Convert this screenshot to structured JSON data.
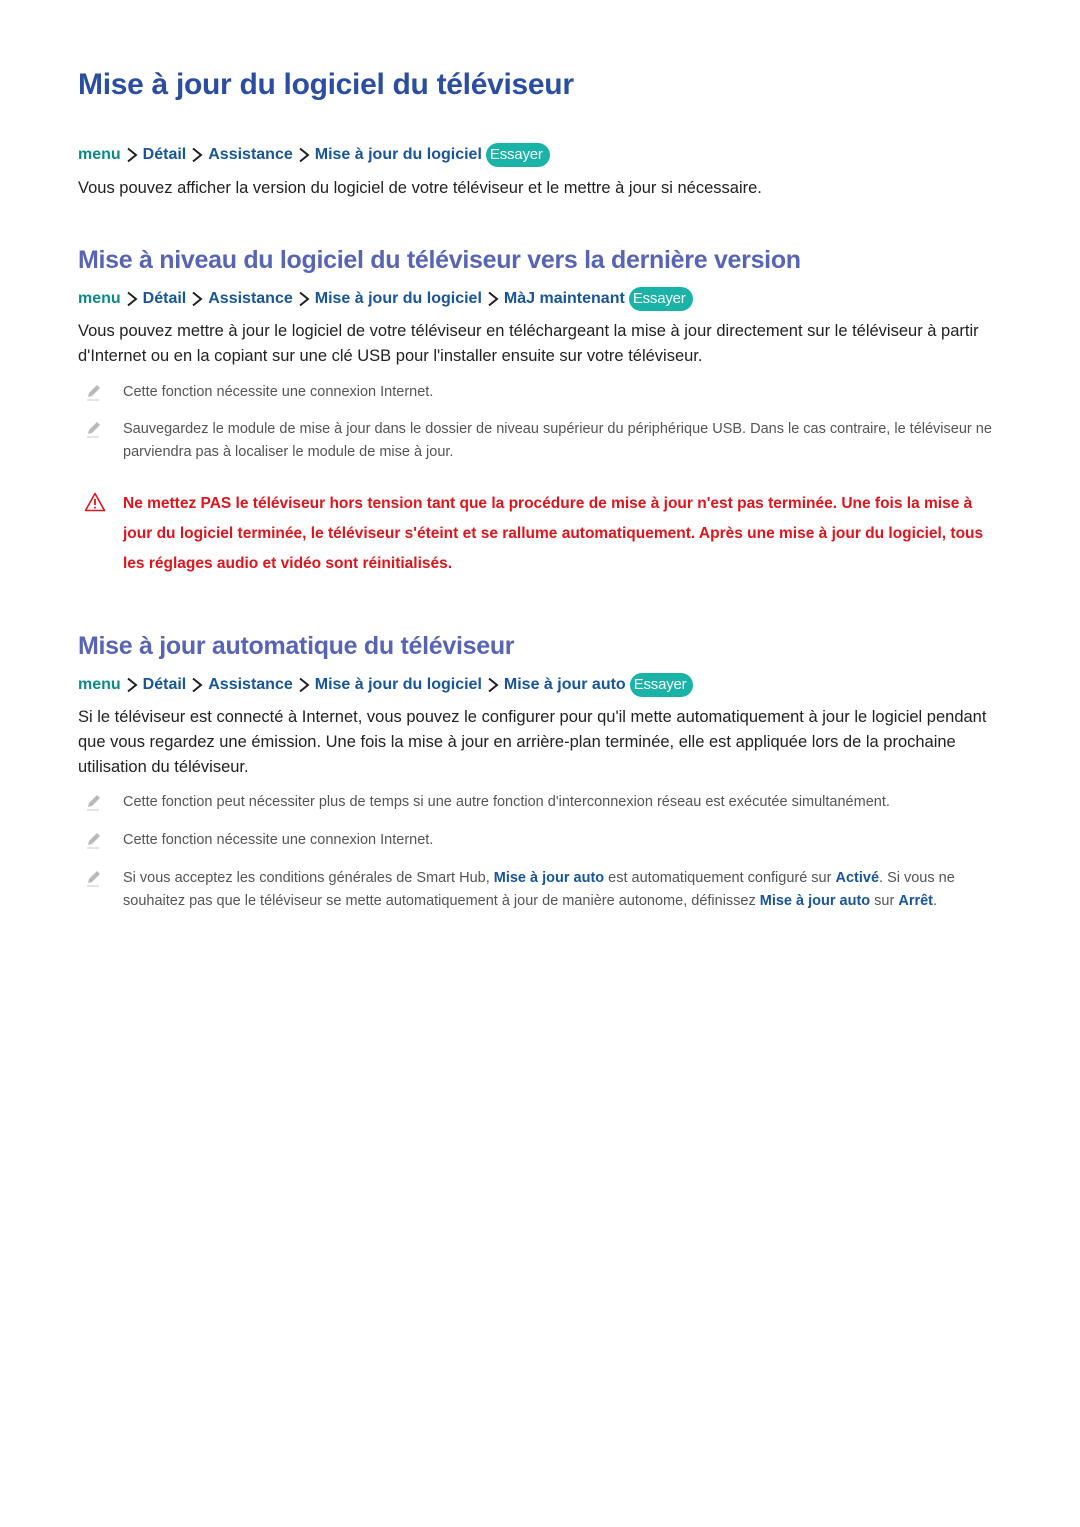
{
  "colors": {
    "title": "#2b4ea2",
    "subtitle": "#5865b6",
    "breadcrumb_root": "#0b8a8a",
    "breadcrumb_item": "#17559c",
    "try_badge": "#1ab3a8",
    "warning": "#e2141b",
    "note_text": "#555555"
  },
  "main_title": "Mise à jour du logiciel du téléviseur",
  "section1": {
    "breadcrumb": {
      "root": "menu",
      "items": [
        "Détail",
        "Assistance",
        "Mise à jour du logiciel"
      ],
      "try_label": "Essayer"
    },
    "body": "Vous pouvez afficher la version du logiciel de votre téléviseur et le mettre à jour si nécessaire."
  },
  "section2": {
    "title": "Mise à niveau du logiciel du téléviseur vers la dernière version",
    "breadcrumb": {
      "root": "menu",
      "items": [
        "Détail",
        "Assistance",
        "Mise à jour du logiciel",
        "MàJ maintenant"
      ],
      "try_label": "Essayer"
    },
    "body": "Vous pouvez mettre à jour le logiciel de votre téléviseur en téléchargeant la mise à jour directement sur le téléviseur à partir d'Internet ou en la copiant sur une clé USB pour l'installer ensuite sur votre téléviseur.",
    "notes": [
      {
        "icon": "pencil-note-icon",
        "text": "Cette fonction nécessite une connexion Internet."
      },
      {
        "icon": "pencil-note-icon",
        "text": "Sauvegardez le module de mise à jour dans le dossier de niveau supérieur du périphérique USB. Dans le cas contraire, le téléviseur ne parviendra pas à localiser le module de mise à jour."
      }
    ],
    "warning": {
      "icon": "warning-triangle-icon",
      "text": "Ne mettez PAS le téléviseur hors tension tant que la procédure de mise à jour n'est pas terminée. Une fois la mise à jour du logiciel terminée, le téléviseur s'éteint et se rallume automatiquement. Après une mise à jour du logiciel, tous les réglages audio et vidéo sont réinitialisés."
    }
  },
  "section3": {
    "title": "Mise à jour automatique du téléviseur",
    "breadcrumb": {
      "root": "menu",
      "items": [
        "Détail",
        "Assistance",
        "Mise à jour du logiciel",
        "Mise à jour auto"
      ],
      "try_label": "Essayer"
    },
    "body": "Si le téléviseur est connecté à Internet, vous pouvez le configurer pour qu'il mette automatiquement à jour le logiciel pendant que vous regardez une émission. Une fois la mise à jour en arrière-plan terminée, elle est appliquée lors de la prochaine utilisation du téléviseur.",
    "notes": [
      {
        "icon": "pencil-note-icon",
        "text": "Cette fonction peut nécessiter plus de temps si une autre fonction d'interconnexion réseau est exécutée simultanément."
      },
      {
        "icon": "pencil-note-icon",
        "text": "Cette fonction nécessite une connexion Internet."
      }
    ],
    "note3": {
      "icon": "pencil-note-icon",
      "part1": "Si vous acceptez les conditions générales de Smart Hub, ",
      "term1": "Mise à jour auto",
      "part2": " est automatiquement configuré sur ",
      "term2": "Activé",
      "part3": ". Si vous ne souhaitez pas que le téléviseur se mette automatiquement à jour de manière autonome, définissez ",
      "term3": "Mise à jour auto",
      "part4": " sur ",
      "term4": "Arrêt",
      "part5": "."
    }
  }
}
